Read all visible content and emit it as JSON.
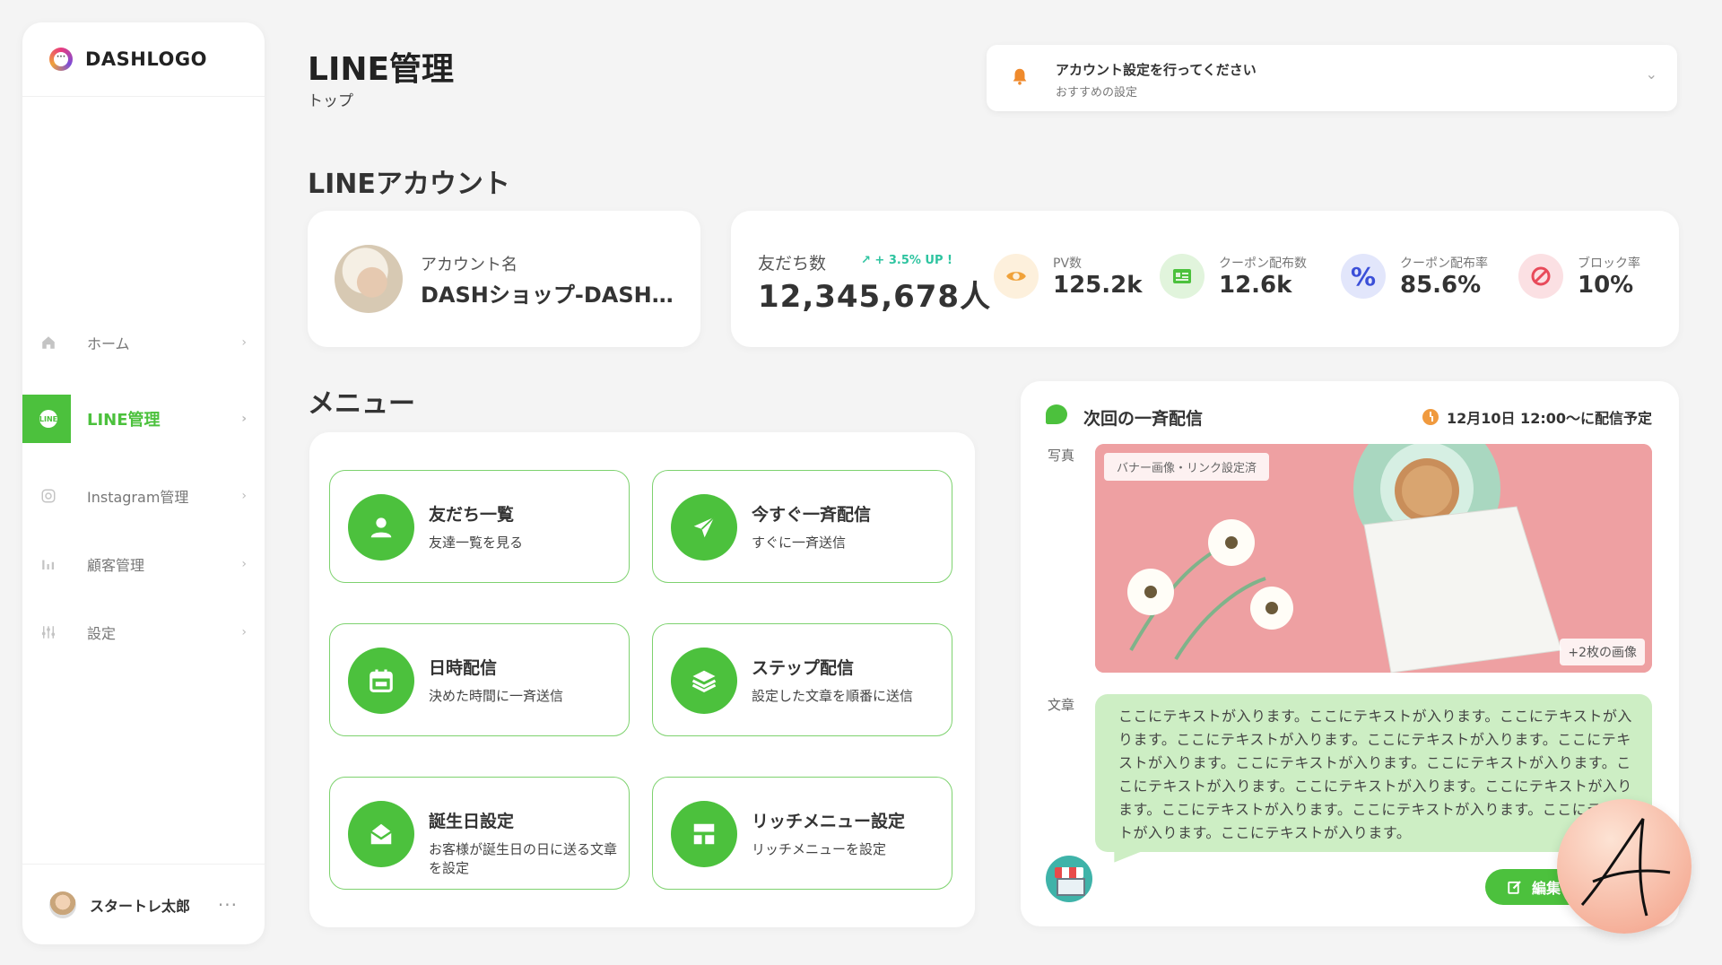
{
  "logo": {
    "text": "DASHLOGO"
  },
  "nav": {
    "items": [
      {
        "label": "ホーム",
        "icon": "home-icon"
      },
      {
        "label": "LINE管理",
        "icon": "line-icon",
        "badge": "LINE",
        "active": true
      },
      {
        "label": "Instagram管理",
        "icon": "instagram-icon"
      },
      {
        "label": "顧客管理",
        "icon": "bar-chart-icon"
      },
      {
        "label": "設定",
        "icon": "sliders-icon"
      }
    ],
    "chevron": "›"
  },
  "user": {
    "name": "スタートレ太郎",
    "more": "···"
  },
  "header": {
    "title": "LINE管理",
    "breadcrumb": "トップ"
  },
  "notice": {
    "title": "アカウント設定を行ってください",
    "subtitle": "おすすめの設定",
    "chevron": "⌄"
  },
  "sections": {
    "account": "LINEアカウント",
    "menu": "メニュー"
  },
  "account": {
    "label": "アカウント名",
    "name": "DASHショップ-DASH…"
  },
  "stats": {
    "friends_label": "友だち数",
    "friends_change": "↗  + 3.5% UP !",
    "friends_value": "12,345,678人",
    "items": [
      {
        "label": "PV数",
        "value": "125.2k",
        "icon": "eye-icon",
        "color": "#f0a23a",
        "bg": "#fdf0dc"
      },
      {
        "label": "クーポン配布数",
        "value": "12.6k",
        "icon": "coupon-icon",
        "color": "#4cc13d",
        "bg": "#e1f4dc"
      },
      {
        "label": "クーポン配布率",
        "value": "85.6%",
        "icon": "percent-icon",
        "color": "#3b4fd8",
        "bg": "#e2e6fb",
        "glyph": "%"
      },
      {
        "label": "ブロック率",
        "value": "10%",
        "icon": "block-icon",
        "color": "#e84a5a",
        "bg": "#fbe0e3"
      }
    ]
  },
  "menu": {
    "items": [
      {
        "title": "友だち一覧",
        "subtitle": "友達一覧を見る",
        "icon": "user-icon"
      },
      {
        "title": "今すぐ一斉配信",
        "subtitle": "すぐに一斉送信",
        "icon": "send-icon"
      },
      {
        "title": "日時配信",
        "subtitle": "決めた時間に一斉送信",
        "icon": "calendar-icon"
      },
      {
        "title": "ステップ配信",
        "subtitle": "設定した文章を順番に送信",
        "icon": "layers-icon"
      },
      {
        "title": "誕生日設定",
        "subtitle": "お客様が誕生日の日に送る文章を設定",
        "icon": "mail-open-icon"
      },
      {
        "title": "リッチメニュー設定",
        "subtitle": "リッチメニューを設定",
        "icon": "layout-icon"
      }
    ]
  },
  "broadcast": {
    "title": "次回の一斉配信",
    "schedule": "12月10日 12:00〜に配信予定",
    "photo_label": "写真",
    "photo_tag": "バナー画像・リンク設定済",
    "photo_more": "+2枚の画像",
    "text_label": "文章",
    "message": "ここにテキストが入ります。ここにテキストが入ります。ここにテキストが入ります。ここにテキストが入ります。ここにテキストが入ります。ここにテキストが入ります。ここにテキストが入ります。ここにテキストが入ります。ここにテキストが入ります。ここにテキストが入ります。ここにテキストが入ります。ここにテキストが入ります。ここにテキストが入ります。ここにテキストが入ります。ここにテキストが入ります。",
    "edit_label": "編集"
  },
  "accent_color": "#4cc13d"
}
